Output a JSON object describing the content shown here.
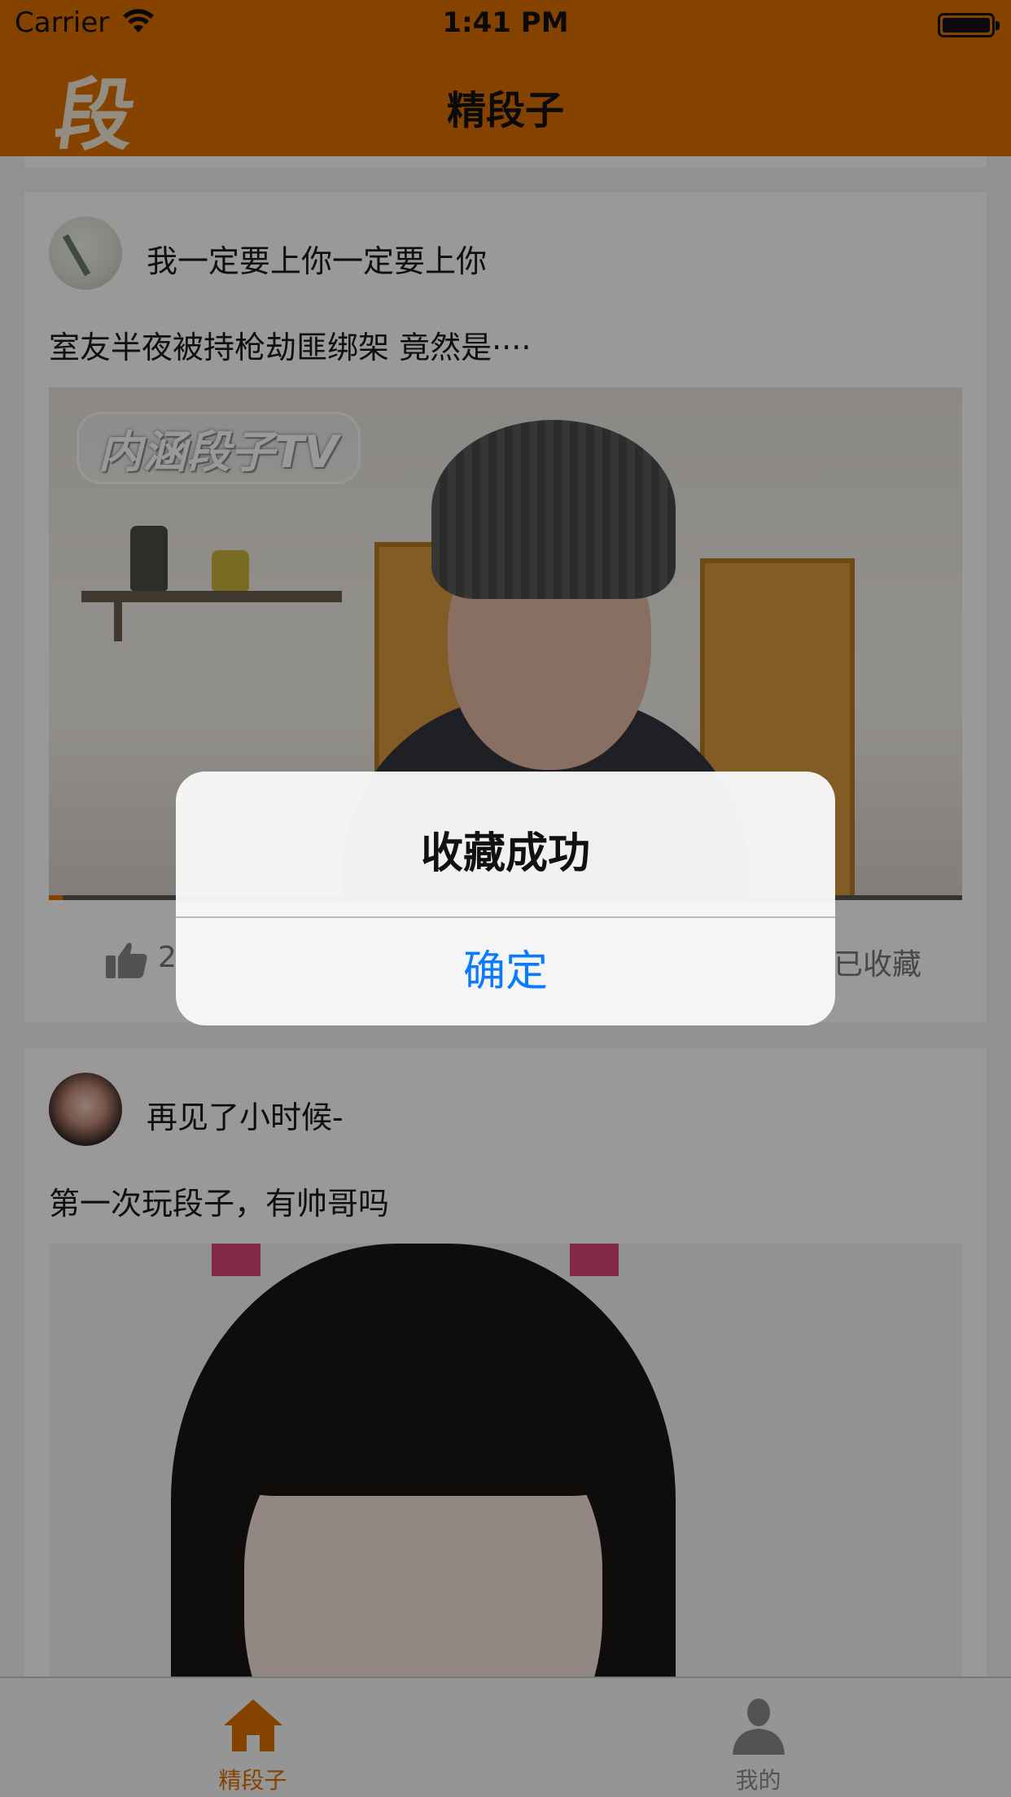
{
  "status_bar": {
    "carrier": "Carrier",
    "time": "1:41 PM"
  },
  "nav": {
    "logo": "段",
    "title": "精段子"
  },
  "posts": [
    {
      "username": "我一定要上你一定要上你",
      "text": "室友半夜被持枪劫匪绑架 竟然是····",
      "media": {
        "watermark": "内涵段子TV"
      },
      "like_count": "2",
      "favorite_label": "已收藏"
    },
    {
      "username": "再见了小时候-",
      "text": "第一次玩段子，有帅哥吗"
    }
  ],
  "tabbar": {
    "items": [
      {
        "label": "精段子",
        "icon": "home-icon",
        "selected": true
      },
      {
        "label": "我的",
        "icon": "person-icon",
        "selected": false
      }
    ]
  },
  "alert": {
    "title": "收藏成功",
    "button": "确定"
  },
  "colors": {
    "brand": "#e07000",
    "alert_button": "#0a7aff",
    "tab_inactive": "#8a8a8a"
  }
}
